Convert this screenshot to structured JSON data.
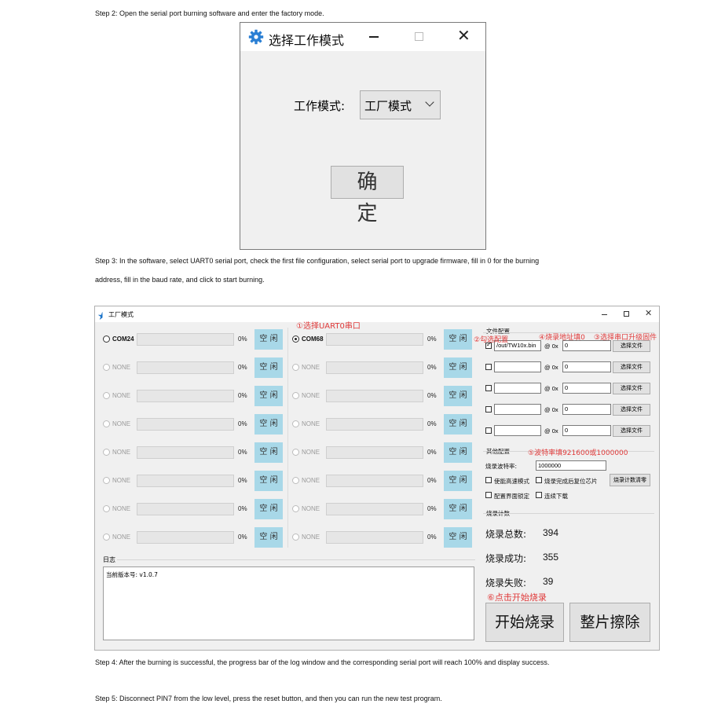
{
  "steps": {
    "step2": "Step 2: Open the serial port burning software and enter the factory mode.",
    "step3_line1": "Step 3: In the software, select UART0 serial port, check the first file configuration, select serial port to upgrade firmware, fill in 0 for the burning",
    "step3_line2": "address, fill in the baud rate, and click to start burning.",
    "step4": "Step 4: After the burning is successful, the progress bar of the log window and the corresponding serial port will reach 100% and display success.",
    "step5": "Step 5: Disconnect PIN7 from the low level, press the reset button, and then you can run the new test program."
  },
  "dialog": {
    "title": "选择工作模式",
    "icon": "gear-icon",
    "mode_label": "工作模式:",
    "mode_value": "工厂模式",
    "ok_label": "确 定"
  },
  "window": {
    "title": "工厂模式",
    "ports": [
      {
        "name": "COM24",
        "pct": "0%",
        "status": "空 闲",
        "active": true,
        "selected": false
      },
      {
        "name": "COM68",
        "pct": "0%",
        "status": "空 闲",
        "active": true,
        "selected": true
      },
      {
        "name": "NONE",
        "pct": "0%",
        "status": "空 闲",
        "active": false,
        "selected": false
      },
      {
        "name": "NONE",
        "pct": "0%",
        "status": "空 闲",
        "active": false,
        "selected": false
      },
      {
        "name": "NONE",
        "pct": "0%",
        "status": "空 闲",
        "active": false,
        "selected": false
      },
      {
        "name": "NONE",
        "pct": "0%",
        "status": "空 闲",
        "active": false,
        "selected": false
      },
      {
        "name": "NONE",
        "pct": "0%",
        "status": "空 闲",
        "active": false,
        "selected": false
      },
      {
        "name": "NONE",
        "pct": "0%",
        "status": "空 闲",
        "active": false,
        "selected": false
      },
      {
        "name": "NONE",
        "pct": "0%",
        "status": "空 闲",
        "active": false,
        "selected": false
      },
      {
        "name": "NONE",
        "pct": "0%",
        "status": "空 闲",
        "active": false,
        "selected": false
      },
      {
        "name": "NONE",
        "pct": "0%",
        "status": "空 闲",
        "active": false,
        "selected": false
      },
      {
        "name": "NONE",
        "pct": "0%",
        "status": "空 闲",
        "active": false,
        "selected": false
      },
      {
        "name": "NONE",
        "pct": "0%",
        "status": "空 闲",
        "active": false,
        "selected": false
      },
      {
        "name": "NONE",
        "pct": "0%",
        "status": "空 闲",
        "active": false,
        "selected": false
      },
      {
        "name": "NONE",
        "pct": "0%",
        "status": "空 闲",
        "active": false,
        "selected": false
      },
      {
        "name": "NONE",
        "pct": "0%",
        "status": "空 闲",
        "active": false,
        "selected": false
      }
    ],
    "log": {
      "label": "日志",
      "text": "当前版本号: v1.0.7"
    },
    "file_config": {
      "label": "文件配置",
      "rows": [
        {
          "checked": true,
          "path": "/out/TW10x.bin",
          "at": "@ 0x",
          "addr": "0",
          "button": "选择文件"
        },
        {
          "checked": false,
          "path": "",
          "at": "@ 0x",
          "addr": "0",
          "button": "选择文件"
        },
        {
          "checked": false,
          "path": "",
          "at": "@ 0x",
          "addr": "0",
          "button": "选择文件"
        },
        {
          "checked": false,
          "path": "",
          "at": "@ 0x",
          "addr": "0",
          "button": "选择文件"
        },
        {
          "checked": false,
          "path": "",
          "at": "@ 0x",
          "addr": "0",
          "button": "选择文件"
        }
      ]
    },
    "other_config": {
      "label": "其他配置",
      "baud_label": "烧录波特率:",
      "baud_value": "1000000",
      "opt_highspeed": "使能高速模式",
      "opt_reset": "烧录完成后复位芯片",
      "clear_button": "烧录计数清零",
      "opt_lock": "配置界面锁定",
      "opt_continuous": "连续下载"
    },
    "counts": {
      "label": "烧录计数",
      "total_label": "烧录总数:",
      "total": "394",
      "success_label": "烧录成功:",
      "success": "355",
      "fail_label": "烧录失败:",
      "fail": "39"
    },
    "start_button": "开始烧录",
    "erase_button": "整片擦除"
  },
  "annotations": {
    "a1": "①选择UART0串口",
    "a2": "②勾选配置",
    "a3": "③选择串口升级固件",
    "a4": "④烧录地址填0",
    "a5": "⑤波特率填921600或1000000",
    "a6": "⑥点击开始烧录"
  },
  "colors": {
    "status_button": "#a8d8e8",
    "annotation": "#e03a3a"
  }
}
